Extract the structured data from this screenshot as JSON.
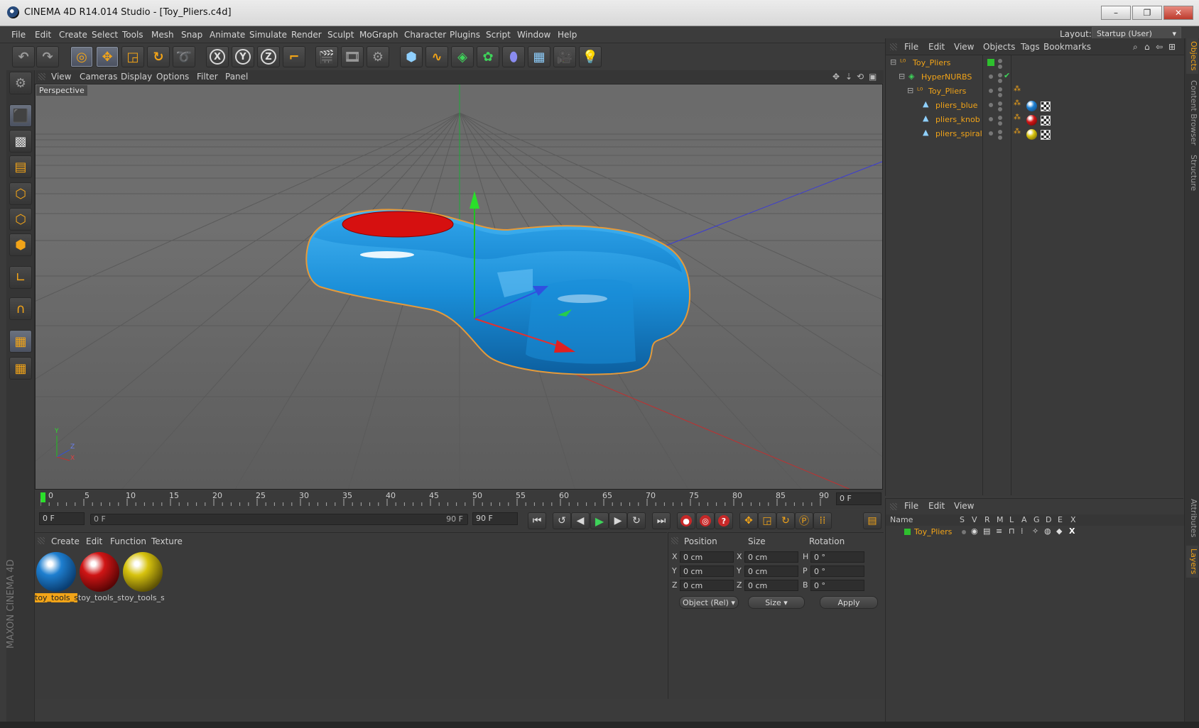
{
  "window": {
    "title": "CINEMA 4D R14.014 Studio - [Toy_Pliers.c4d]",
    "buttons": [
      "–",
      "❐",
      "✕"
    ]
  },
  "menubar": {
    "items": [
      "File",
      "Edit",
      "Create",
      "Select",
      "Tools",
      "Mesh",
      "Snap",
      "Animate",
      "Simulate",
      "Render",
      "Sculpt",
      "MoGraph",
      "Character",
      "Plugins",
      "Script",
      "Window",
      "Help"
    ],
    "layout_label": "Layout:",
    "layout_value": "Startup (User)"
  },
  "toolbar": {
    "tools": [
      "undo-icon",
      "redo-icon",
      "live-selection-icon",
      "move-icon",
      "scale-icon",
      "rotate-icon",
      "recent-tools-icon",
      "x-axis-lock-icon",
      "y-axis-lock-icon",
      "z-axis-lock-icon",
      "coordinate-system-icon",
      "render-view-icon",
      "render-picture-viewer-icon",
      "render-settings-icon",
      "cube-icon",
      "spline-pen-icon",
      "nurbs-icon",
      "array-icon",
      "deformer-icon",
      "floor-icon",
      "camera-icon",
      "light-icon"
    ],
    "axis_labels": [
      "X",
      "Y",
      "Z"
    ]
  },
  "viewport": {
    "menu": [
      "View",
      "Cameras",
      "Display",
      "Options",
      "Filter",
      "Panel"
    ],
    "camera_label": "Perspective",
    "axis_indicator": [
      "Y",
      "Z",
      "X"
    ]
  },
  "timeline": {
    "ticks": [
      "0",
      "5",
      "10",
      "15",
      "20",
      "25",
      "30",
      "35",
      "40",
      "45",
      "50",
      "55",
      "60",
      "65",
      "70",
      "75",
      "80",
      "85",
      "90"
    ],
    "current_frame": "0 F",
    "start_frame": "0 F",
    "range_start": "0 F",
    "range_end": "90 F",
    "end_frame": "90 F"
  },
  "materials": {
    "menu": [
      "Create",
      "Edit",
      "Function",
      "Texture"
    ],
    "items": [
      {
        "label": "toy_tools_s",
        "color": "#1e7fd0",
        "selected": true
      },
      {
        "label": "toy_tools_s",
        "color": "#d01515",
        "selected": false
      },
      {
        "label": "toy_tools_s",
        "color": "#d7c30e",
        "selected": false
      }
    ]
  },
  "coordinates": {
    "headers": [
      "Position",
      "Size",
      "Rotation"
    ],
    "rows": [
      {
        "axis": "X",
        "pos": "0 cm",
        "size_axis": "X",
        "size": "0 cm",
        "rot_axis": "H",
        "rot": "0 °"
      },
      {
        "axis": "Y",
        "pos": "0 cm",
        "size_axis": "Y",
        "size": "0 cm",
        "rot_axis": "P",
        "rot": "0 °"
      },
      {
        "axis": "Z",
        "pos": "0 cm",
        "size_axis": "Z",
        "size": "0 cm",
        "rot_axis": "B",
        "rot": "0 °"
      }
    ],
    "mode_select": "Object (Rel)",
    "size_select": "Size",
    "apply_label": "Apply"
  },
  "objects": {
    "menu": [
      "File",
      "Edit",
      "View",
      "Objects",
      "Tags",
      "Bookmarks"
    ],
    "tree": [
      {
        "name": "Toy_Pliers"
      },
      {
        "name": "HyperNURBS"
      },
      {
        "name": "Toy_Pliers"
      },
      {
        "name": "pliers_blue",
        "material": "#1e7fd0"
      },
      {
        "name": "pliers_knob",
        "material": "#d01515"
      },
      {
        "name": "pliers_spiral",
        "material": "#d7c30e"
      }
    ]
  },
  "layers": {
    "menu": [
      "File",
      "Edit",
      "View"
    ],
    "columns": [
      "Name",
      "S",
      "V",
      "R",
      "M",
      "L",
      "A",
      "G",
      "D",
      "E",
      "X"
    ],
    "row_name": "Toy_Pliers"
  },
  "side_tabs": [
    "Objects",
    "Content Browser",
    "Structure",
    "Attributes",
    "Layers"
  ],
  "branding": "MAXON CINEMA 4D",
  "colors": {
    "accent": "#f2a418",
    "selection": "#f2a418",
    "bg": "#3b3b3b"
  }
}
